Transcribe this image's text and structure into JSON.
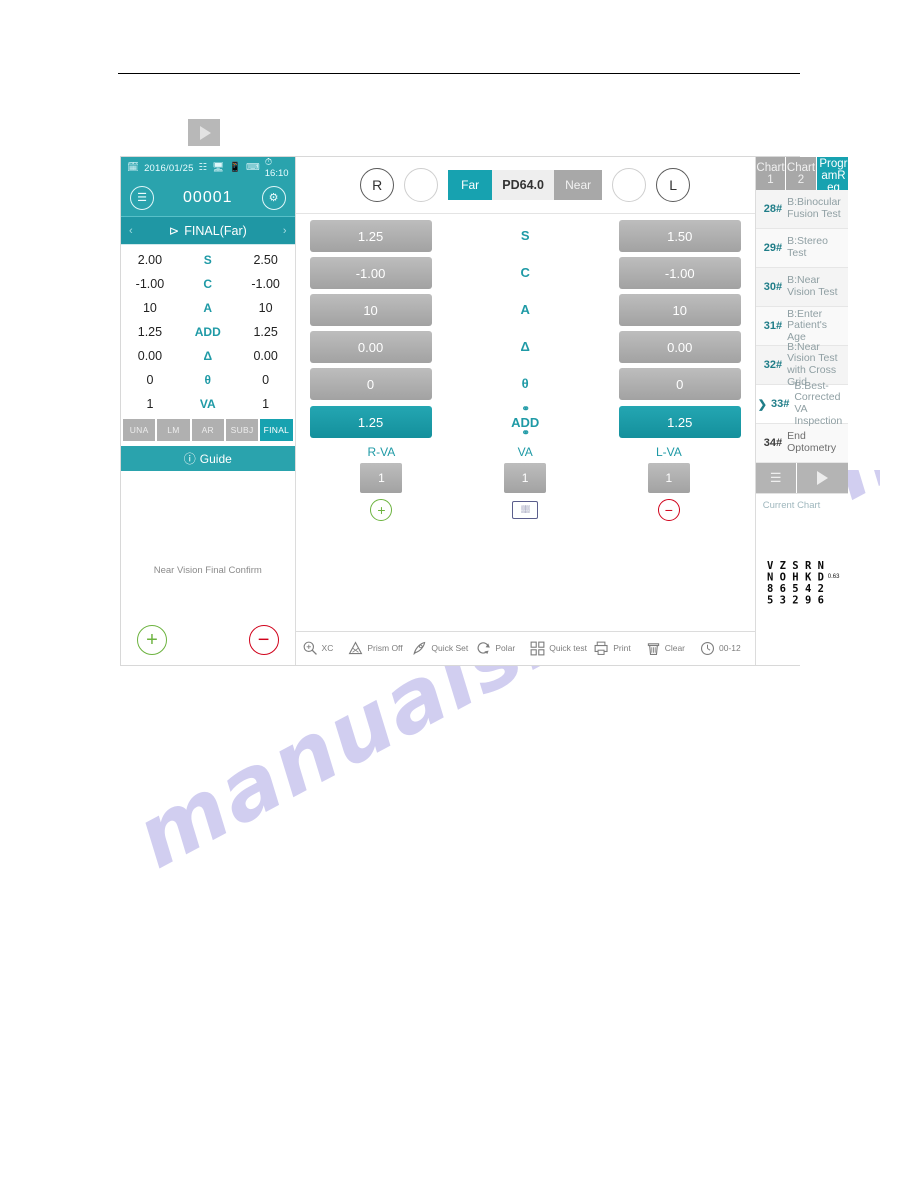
{
  "page": {
    "watermark": "manualshive.com",
    "play_button_icon": "play-icon"
  },
  "left_panel": {
    "status_bar": {
      "date": "2016/01/25",
      "time": "16:10",
      "icons": [
        "calendar-icon",
        "network-icon",
        "monitor-icon",
        "battery-icon",
        "keyboard-icon",
        "clock-icon"
      ]
    },
    "id_bar": {
      "menu_icon": "hamburger-icon",
      "patient_id": "00001",
      "settings_icon": "gear-icon"
    },
    "mode_bar": {
      "prev_icon": "chevron-left-icon",
      "share_icon": "share-icon",
      "label": "FINAL(Far)",
      "next_icon": "chevron-right-icon"
    },
    "measurements": [
      {
        "left": "2.00",
        "label": "S",
        "right": "2.50"
      },
      {
        "left": "-1.00",
        "label": "C",
        "right": "-1.00"
      },
      {
        "left": "10",
        "label": "A",
        "right": "10"
      },
      {
        "left": "1.25",
        "label": "ADD",
        "right": "1.25"
      },
      {
        "left": "0.00",
        "label": "Δ",
        "right": "0.00"
      },
      {
        "left": "0",
        "label": "θ",
        "right": "0"
      },
      {
        "left": "1",
        "label": "VA",
        "right": "1"
      }
    ],
    "segments": [
      {
        "label": "UNA",
        "active": false
      },
      {
        "label": "LM",
        "active": false
      },
      {
        "label": "AR",
        "active": false
      },
      {
        "label": "SUBJ",
        "active": false
      },
      {
        "label": "FINAL",
        "active": true
      }
    ],
    "guide": {
      "icon": "question-mark-icon",
      "title": "Guide",
      "message": "Near Vision Final Confirm",
      "plus_label": "+",
      "minus_label": "−"
    }
  },
  "center_panel": {
    "top_bar": {
      "right_eye_label": "R",
      "left_eye_label": "L",
      "far_label": "Far",
      "pd_value": "PD64.0",
      "near_label": "Near"
    },
    "rx_rows": [
      {
        "label": "S",
        "right_value": "1.25",
        "left_value": "1.50",
        "highlight": false
      },
      {
        "label": "C",
        "right_value": "-1.00",
        "left_value": "-1.00",
        "highlight": false
      },
      {
        "label": "A",
        "right_value": "10",
        "left_value": "10",
        "highlight": false
      },
      {
        "label": "Δ",
        "right_value": "0.00",
        "left_value": "0.00",
        "highlight": false
      },
      {
        "label": "θ",
        "right_value": "0",
        "left_value": "0",
        "highlight": false
      },
      {
        "label": "ADD",
        "right_value": "1.25",
        "left_value": "1.25",
        "highlight": true
      }
    ],
    "va_section": [
      {
        "header": "R-VA",
        "value": "1",
        "icon": "rotate-plus-icon"
      },
      {
        "header": "VA",
        "value": "1",
        "icon": "keyboard-icon"
      },
      {
        "header": "L-VA",
        "value": "1",
        "icon": "rotate-minus-icon"
      }
    ],
    "toolbar": [
      {
        "icon": "cross-cylinder-icon",
        "label": "XC"
      },
      {
        "icon": "prism-icon",
        "label": "Prism Off"
      },
      {
        "icon": "rocket-icon",
        "label": "Quick Set"
      },
      {
        "icon": "polar-icon",
        "label": "Polar"
      },
      {
        "icon": "grid-icon",
        "label": "Quick test"
      },
      {
        "icon": "printer-icon",
        "label": "Print"
      },
      {
        "icon": "trash-icon",
        "label": "Clear"
      },
      {
        "icon": "clock-icon",
        "label": "00-12"
      }
    ]
  },
  "right_panel": {
    "tabs": [
      {
        "label": "Chart 1",
        "active": false
      },
      {
        "label": "Chart 2",
        "active": false
      },
      {
        "label": "ProgramReg",
        "active": true
      }
    ],
    "programs": [
      {
        "no": "28#",
        "name": "B:Binocular Fusion Test",
        "active": false
      },
      {
        "no": "29#",
        "name": "B:Stereo Test",
        "active": false
      },
      {
        "no": "30#",
        "name": "B:Near Vision Test",
        "active": false
      },
      {
        "no": "31#",
        "name": "B:Enter Patient's Age",
        "active": false
      },
      {
        "no": "32#",
        "name": "B:Near Vision Test with Cross Grid",
        "active": false
      },
      {
        "no": "33#",
        "name": "B:Best-Corrected VA Inspection",
        "active": true
      },
      {
        "no": "34#",
        "name": "End Optometry",
        "active": false
      }
    ],
    "controls": {
      "menu_icon": "hamburger-icon",
      "play_icon": "play-icon"
    },
    "preview": {
      "title": "Current Chart",
      "chart_columns": [
        "VN85",
        "ZO63",
        "SH52",
        "RK49",
        "ND26"
      ],
      "chart_score": "0.63"
    }
  },
  "colors": {
    "teal": "#2aa3ad",
    "teal_dark": "#17a2b0",
    "gray_button": "#a8a8a8",
    "green": "#6cb33f",
    "red": "#d0021b",
    "watermark": "#c9c6ee"
  }
}
